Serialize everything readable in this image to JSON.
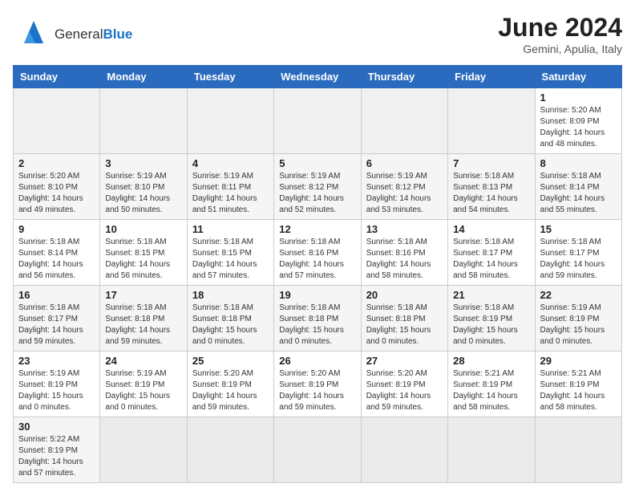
{
  "header": {
    "logo_general": "General",
    "logo_blue": "Blue",
    "month_title": "June 2024",
    "subtitle": "Gemini, Apulia, Italy"
  },
  "weekdays": [
    "Sunday",
    "Monday",
    "Tuesday",
    "Wednesday",
    "Thursday",
    "Friday",
    "Saturday"
  ],
  "weeks": [
    [
      {
        "day": "",
        "empty": true
      },
      {
        "day": "",
        "empty": true
      },
      {
        "day": "",
        "empty": true
      },
      {
        "day": "",
        "empty": true
      },
      {
        "day": "",
        "empty": true
      },
      {
        "day": "",
        "empty": true
      },
      {
        "day": "1",
        "sunrise": "Sunrise: 5:20 AM",
        "sunset": "Sunset: 8:09 PM",
        "daylight": "Daylight: 14 hours and 48 minutes."
      }
    ],
    [
      {
        "day": "2",
        "sunrise": "Sunrise: 5:20 AM",
        "sunset": "Sunset: 8:10 PM",
        "daylight": "Daylight: 14 hours and 49 minutes."
      },
      {
        "day": "3",
        "sunrise": "Sunrise: 5:19 AM",
        "sunset": "Sunset: 8:10 PM",
        "daylight": "Daylight: 14 hours and 50 minutes."
      },
      {
        "day": "4",
        "sunrise": "Sunrise: 5:19 AM",
        "sunset": "Sunset: 8:11 PM",
        "daylight": "Daylight: 14 hours and 51 minutes."
      },
      {
        "day": "5",
        "sunrise": "Sunrise: 5:19 AM",
        "sunset": "Sunset: 8:12 PM",
        "daylight": "Daylight: 14 hours and 52 minutes."
      },
      {
        "day": "6",
        "sunrise": "Sunrise: 5:19 AM",
        "sunset": "Sunset: 8:12 PM",
        "daylight": "Daylight: 14 hours and 53 minutes."
      },
      {
        "day": "7",
        "sunrise": "Sunrise: 5:18 AM",
        "sunset": "Sunset: 8:13 PM",
        "daylight": "Daylight: 14 hours and 54 minutes."
      },
      {
        "day": "8",
        "sunrise": "Sunrise: 5:18 AM",
        "sunset": "Sunset: 8:14 PM",
        "daylight": "Daylight: 14 hours and 55 minutes."
      }
    ],
    [
      {
        "day": "9",
        "sunrise": "Sunrise: 5:18 AM",
        "sunset": "Sunset: 8:14 PM",
        "daylight": "Daylight: 14 hours and 56 minutes."
      },
      {
        "day": "10",
        "sunrise": "Sunrise: 5:18 AM",
        "sunset": "Sunset: 8:15 PM",
        "daylight": "Daylight: 14 hours and 56 minutes."
      },
      {
        "day": "11",
        "sunrise": "Sunrise: 5:18 AM",
        "sunset": "Sunset: 8:15 PM",
        "daylight": "Daylight: 14 hours and 57 minutes."
      },
      {
        "day": "12",
        "sunrise": "Sunrise: 5:18 AM",
        "sunset": "Sunset: 8:16 PM",
        "daylight": "Daylight: 14 hours and 57 minutes."
      },
      {
        "day": "13",
        "sunrise": "Sunrise: 5:18 AM",
        "sunset": "Sunset: 8:16 PM",
        "daylight": "Daylight: 14 hours and 58 minutes."
      },
      {
        "day": "14",
        "sunrise": "Sunrise: 5:18 AM",
        "sunset": "Sunset: 8:17 PM",
        "daylight": "Daylight: 14 hours and 58 minutes."
      },
      {
        "day": "15",
        "sunrise": "Sunrise: 5:18 AM",
        "sunset": "Sunset: 8:17 PM",
        "daylight": "Daylight: 14 hours and 59 minutes."
      }
    ],
    [
      {
        "day": "16",
        "sunrise": "Sunrise: 5:18 AM",
        "sunset": "Sunset: 8:17 PM",
        "daylight": "Daylight: 14 hours and 59 minutes."
      },
      {
        "day": "17",
        "sunrise": "Sunrise: 5:18 AM",
        "sunset": "Sunset: 8:18 PM",
        "daylight": "Daylight: 14 hours and 59 minutes."
      },
      {
        "day": "18",
        "sunrise": "Sunrise: 5:18 AM",
        "sunset": "Sunset: 8:18 PM",
        "daylight": "Daylight: 15 hours and 0 minutes."
      },
      {
        "day": "19",
        "sunrise": "Sunrise: 5:18 AM",
        "sunset": "Sunset: 8:18 PM",
        "daylight": "Daylight: 15 hours and 0 minutes."
      },
      {
        "day": "20",
        "sunrise": "Sunrise: 5:18 AM",
        "sunset": "Sunset: 8:18 PM",
        "daylight": "Daylight: 15 hours and 0 minutes."
      },
      {
        "day": "21",
        "sunrise": "Sunrise: 5:18 AM",
        "sunset": "Sunset: 8:19 PM",
        "daylight": "Daylight: 15 hours and 0 minutes."
      },
      {
        "day": "22",
        "sunrise": "Sunrise: 5:19 AM",
        "sunset": "Sunset: 8:19 PM",
        "daylight": "Daylight: 15 hours and 0 minutes."
      }
    ],
    [
      {
        "day": "23",
        "sunrise": "Sunrise: 5:19 AM",
        "sunset": "Sunset: 8:19 PM",
        "daylight": "Daylight: 15 hours and 0 minutes."
      },
      {
        "day": "24",
        "sunrise": "Sunrise: 5:19 AM",
        "sunset": "Sunset: 8:19 PM",
        "daylight": "Daylight: 15 hours and 0 minutes."
      },
      {
        "day": "25",
        "sunrise": "Sunrise: 5:20 AM",
        "sunset": "Sunset: 8:19 PM",
        "daylight": "Daylight: 14 hours and 59 minutes."
      },
      {
        "day": "26",
        "sunrise": "Sunrise: 5:20 AM",
        "sunset": "Sunset: 8:19 PM",
        "daylight": "Daylight: 14 hours and 59 minutes."
      },
      {
        "day": "27",
        "sunrise": "Sunrise: 5:20 AM",
        "sunset": "Sunset: 8:19 PM",
        "daylight": "Daylight: 14 hours and 59 minutes."
      },
      {
        "day": "28",
        "sunrise": "Sunrise: 5:21 AM",
        "sunset": "Sunset: 8:19 PM",
        "daylight": "Daylight: 14 hours and 58 minutes."
      },
      {
        "day": "29",
        "sunrise": "Sunrise: 5:21 AM",
        "sunset": "Sunset: 8:19 PM",
        "daylight": "Daylight: 14 hours and 58 minutes."
      }
    ],
    [
      {
        "day": "30",
        "sunrise": "Sunrise: 5:22 AM",
        "sunset": "Sunset: 8:19 PM",
        "daylight": "Daylight: 14 hours and 57 minutes."
      },
      {
        "day": "",
        "empty": true
      },
      {
        "day": "",
        "empty": true
      },
      {
        "day": "",
        "empty": true
      },
      {
        "day": "",
        "empty": true
      },
      {
        "day": "",
        "empty": true
      },
      {
        "day": "",
        "empty": true
      }
    ]
  ]
}
